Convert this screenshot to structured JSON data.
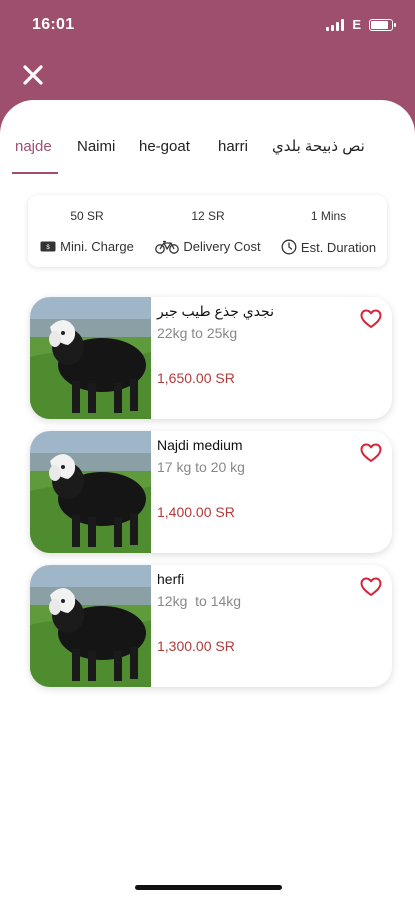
{
  "status_bar": {
    "time": "16:01",
    "network": "E",
    "battery_level": 0.85
  },
  "tabs": [
    {
      "label": "najde",
      "active": true
    },
    {
      "label": "Naimi",
      "active": false
    },
    {
      "label": "he-goat",
      "active": false
    },
    {
      "label": "harri",
      "active": false
    },
    {
      "label": "نص ذبيحة بلدي",
      "active": false
    }
  ],
  "info": {
    "min_charge": {
      "value": "50 SR",
      "label": "Mini. Charge",
      "icon": "money-icon"
    },
    "delivery_cost": {
      "value": "12 SR",
      "label": "Delivery Cost",
      "icon": "bicycle-icon"
    },
    "duration": {
      "value": "1 Mins",
      "label": "Est. Duration",
      "icon": "clock-icon"
    }
  },
  "products": [
    {
      "name": "نجدي جذع طيب جبر",
      "weight": "22kg to 25kg",
      "price": "1,650.00 SR",
      "favorited": false
    },
    {
      "name": "Najdi medium",
      "weight": "17 kg to 20 kg",
      "price": "1,400.00 SR",
      "favorited": false
    },
    {
      "name": "herfi",
      "weight": "12kg  to 14kg",
      "price": "1,300.00 SR",
      "favorited": false
    }
  ],
  "colors": {
    "brand": "#9e4f6d",
    "price": "#b23b3b",
    "favorite": "#d6243a"
  },
  "icons": {
    "close": "close-icon",
    "favorite": "heart-outline-icon"
  }
}
